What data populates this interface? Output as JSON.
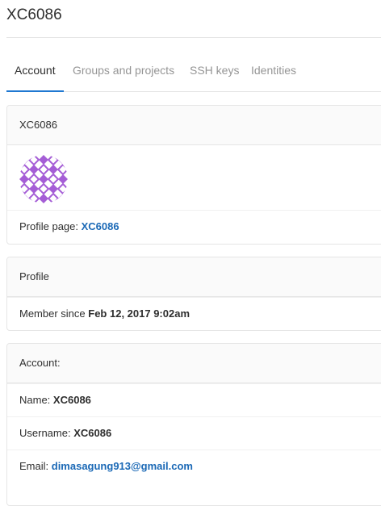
{
  "page": {
    "title": "XC6086"
  },
  "tabs": [
    {
      "label": "Account",
      "active": true
    },
    {
      "label": "Groups and projects",
      "active": false
    },
    {
      "label": "SSH keys",
      "active": false
    },
    {
      "label": "Identities",
      "active": false
    }
  ],
  "user_card": {
    "header": "XC6086",
    "avatar_color": "#a55ed6",
    "profile_label": "Profile page:",
    "profile_link": "XC6086"
  },
  "profile_card": {
    "header": "Profile",
    "member_label": "Member since",
    "member_value": "Feb 12, 2017 9:02am"
  },
  "account_card": {
    "header": "Account:",
    "name_label": "Name:",
    "name_value": "XC6086",
    "username_label": "Username:",
    "username_value": "XC6086",
    "email_label": "Email:",
    "email_value": "dimasagung913@gmail.com"
  },
  "colors": {
    "accent": "#1f78d1",
    "link": "#1b69b6"
  }
}
